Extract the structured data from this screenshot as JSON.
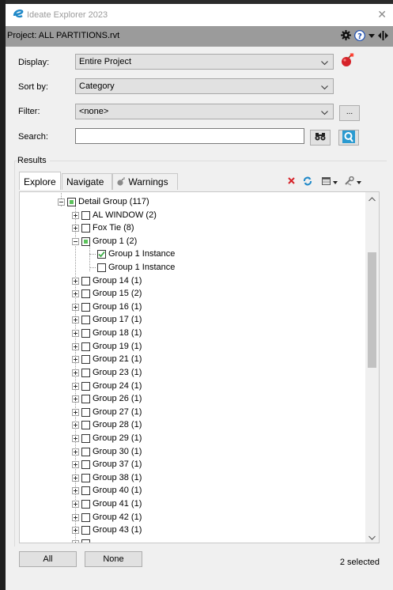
{
  "window": {
    "title": "Ideate Explorer 2023"
  },
  "project": {
    "label": "Project: ALL PARTITIONS.rvt"
  },
  "display": {
    "label": "Display:",
    "value": "Entire Project"
  },
  "sort": {
    "label": "Sort by:",
    "value": "Category"
  },
  "filter": {
    "label": "Filter:",
    "value": "<none>",
    "button": "..."
  },
  "search": {
    "label": "Search:",
    "value": ""
  },
  "results": {
    "label": "Results"
  },
  "tabs": [
    {
      "label": "Explore"
    },
    {
      "label": "Navigate"
    },
    {
      "label": "Warnings"
    }
  ],
  "tree": {
    "root": "Detail Group (117)",
    "items": [
      {
        "label": "AL WINDOW (2)"
      },
      {
        "label": "Fox Tie (8)"
      },
      {
        "label": "Group 1 (2)"
      },
      {
        "label": "Group 1 Instance"
      },
      {
        "label": "Group 1 Instance"
      },
      {
        "label": "Group 14 (1)"
      },
      {
        "label": "Group 15 (2)"
      },
      {
        "label": "Group 16 (1)"
      },
      {
        "label": "Group 17 (1)"
      },
      {
        "label": "Group 18 (1)"
      },
      {
        "label": "Group 19 (1)"
      },
      {
        "label": "Group 21 (1)"
      },
      {
        "label": "Group 23 (1)"
      },
      {
        "label": "Group 24 (1)"
      },
      {
        "label": "Group 26 (1)"
      },
      {
        "label": "Group 27 (1)"
      },
      {
        "label": "Group 28 (1)"
      },
      {
        "label": "Group 29 (1)"
      },
      {
        "label": "Group 30 (1)"
      },
      {
        "label": "Group 37 (1)"
      },
      {
        "label": "Group 38 (1)"
      },
      {
        "label": "Group 40 (1)"
      },
      {
        "label": "Group 41 (1)"
      },
      {
        "label": "Group 42 (1)"
      },
      {
        "label": "Group 43 (1)"
      }
    ]
  },
  "footer": {
    "all": "All",
    "none": "None",
    "status": "2 selected"
  },
  "colors": {
    "accent": "#1e88c8",
    "check": "#3fae49",
    "danger": "#d6232a"
  }
}
